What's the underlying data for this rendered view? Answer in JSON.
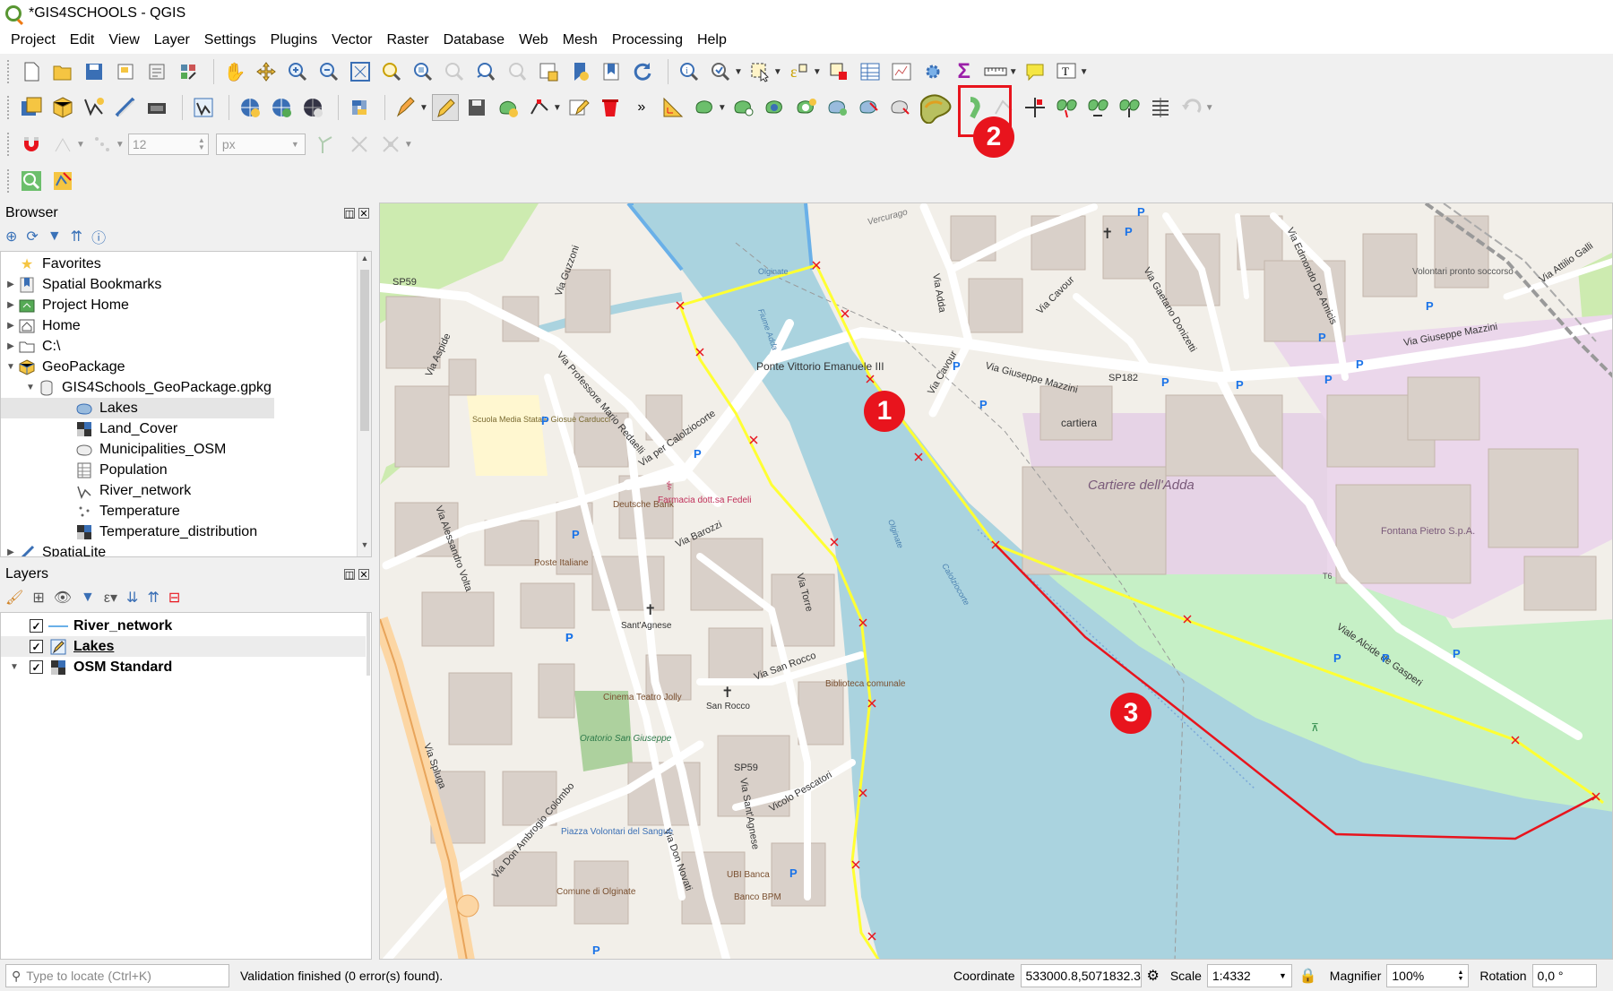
{
  "window": {
    "title": "*GIS4SCHOOLS - QGIS"
  },
  "menu": [
    "Project",
    "Edit",
    "View",
    "Layer",
    "Settings",
    "Plugins",
    "Vector",
    "Raster",
    "Database",
    "Web",
    "Mesh",
    "Processing",
    "Help"
  ],
  "snapping": {
    "tolerance": "12",
    "unit": "px"
  },
  "browser": {
    "title": "Browser",
    "items": [
      {
        "label": "Favorites",
        "icon": "star-icon",
        "level": 0,
        "expander": ""
      },
      {
        "label": "Spatial Bookmarks",
        "icon": "bookmark-icon",
        "level": 0,
        "expander": "▶"
      },
      {
        "label": "Project Home",
        "icon": "project-home-icon",
        "level": 0,
        "expander": "▶"
      },
      {
        "label": "Home",
        "icon": "home-icon",
        "level": 0,
        "expander": "▶"
      },
      {
        "label": "C:\\",
        "icon": "folder-icon",
        "level": 0,
        "expander": "▶"
      },
      {
        "label": "GeoPackage",
        "icon": "geopackage-icon",
        "level": 0,
        "expander": "▼"
      },
      {
        "label": "GIS4Schools_GeoPackage.gpkg",
        "icon": "database-icon",
        "level": 1,
        "expander": "▼"
      },
      {
        "label": "Lakes",
        "icon": "polygon-layer-icon",
        "level": 2,
        "expander": "",
        "selected": true
      },
      {
        "label": "Land_Cover",
        "icon": "raster-layer-icon",
        "level": 2,
        "expander": ""
      },
      {
        "label": "Municipalities_OSM",
        "icon": "polygon-layer-icon",
        "level": 2,
        "expander": ""
      },
      {
        "label": "Population",
        "icon": "table-icon",
        "level": 2,
        "expander": ""
      },
      {
        "label": "River_network",
        "icon": "line-layer-icon",
        "level": 2,
        "expander": ""
      },
      {
        "label": "Temperature",
        "icon": "point-layer-icon",
        "level": 2,
        "expander": ""
      },
      {
        "label": "Temperature_distribution",
        "icon": "raster-layer-icon",
        "level": 2,
        "expander": ""
      },
      {
        "label": "SpatiaLite",
        "icon": "spatialite-icon",
        "level": 0,
        "expander": "▶"
      }
    ]
  },
  "layers": {
    "title": "Layers",
    "items": [
      {
        "label": "River_network",
        "icon": "line-symbol-icon",
        "checked": true,
        "active": false,
        "underline": false,
        "expander": ""
      },
      {
        "label": "Lakes",
        "icon": "edit-pencil-icon",
        "checked": true,
        "active": true,
        "underline": true,
        "expander": ""
      },
      {
        "label": "OSM Standard",
        "icon": "raster-layer-icon",
        "checked": true,
        "active": false,
        "underline": false,
        "expander": "▼"
      }
    ]
  },
  "callouts": [
    "1",
    "2",
    "3"
  ],
  "map_labels": {
    "sp59_a": "SP59",
    "sp59_b": "SP59",
    "sp182": "SP182",
    "ponte": "Ponte Vittorio Emanuele III",
    "cartiera": "cartiera",
    "cartiere": "Cartiere dell'Adda",
    "fontana": "Fontana Pietro S.p.A.",
    "via_mazzini": "Via Giuseppe Mazzini",
    "via_mazzini2": "Via Giuseppe Mazzini",
    "via_cavour": "Via Cavour",
    "via_cavour2": "Via Cavour",
    "via_adda": "Via Adda",
    "via_donizetti": "Via Gaetano Donizetti",
    "via_de_amicis": "Via Edmondo De Amicis",
    "via_aspide": "Via Aspide",
    "via_guzzoni": "Via Guzzoni",
    "via_redaelli": "Via Professore Mario Redaelli",
    "via_calolziocorte": "Via per Calolziocorte",
    "via_barozzi": "Via Barozzi",
    "via_volta": "Via Alessandro Volta",
    "via_torre": "Via Torre",
    "via_san_rocco": "Via San Rocco",
    "via_spluga": "Via Spluga",
    "via_colombo": "Via Don Ambrogio Colombo",
    "via_sant_agnese": "Via Sant'Agnese",
    "via_novati": "Via Don Novati",
    "vicolo_pescatori": "Vicolo Pescatori",
    "viale_gasperi": "Viale Alcide de Gasperi",
    "via_attilio": "Via Attilio Galli",
    "olginate": "Olginate",
    "fiume_adda": "Fiume Adda",
    "calolziocorte": "Calolziocorte",
    "scuola": "Scuola Media Statale Giosuè Carducci",
    "deutsche": "Deutsche Bank",
    "farmacia": "Farmacia dott.sa Fedeli",
    "poste": "Poste Italiane",
    "sant_agnese": "Sant'Agnese",
    "cinema": "Cinema Teatro Jolly",
    "oratorio": "Oratorio San Giuseppe",
    "san_rocco": "San Rocco",
    "biblioteca": "Biblioteca comunale",
    "piazza": "Piazza Volontari del Sangue",
    "comune": "Comune di Olginate",
    "ubi": "UBI Banca",
    "banco": "Banco BPM",
    "volontari": "Volontari pronto soccorso",
    "vercurago": "Vercurago",
    "sp59_c": "SP59",
    "t6": "T6"
  },
  "status": {
    "locate_placeholder": "Type to locate (Ctrl+K)",
    "message": "Validation finished (0 error(s) found).",
    "coordinate_label": "Coordinate",
    "coordinate": "533000.8,5071832.3",
    "scale_label": "Scale",
    "scale": "1:4332",
    "magnifier_label": "Magnifier",
    "magnifier": "100%",
    "rotation_label": "Rotation",
    "rotation": "0,0 °"
  }
}
